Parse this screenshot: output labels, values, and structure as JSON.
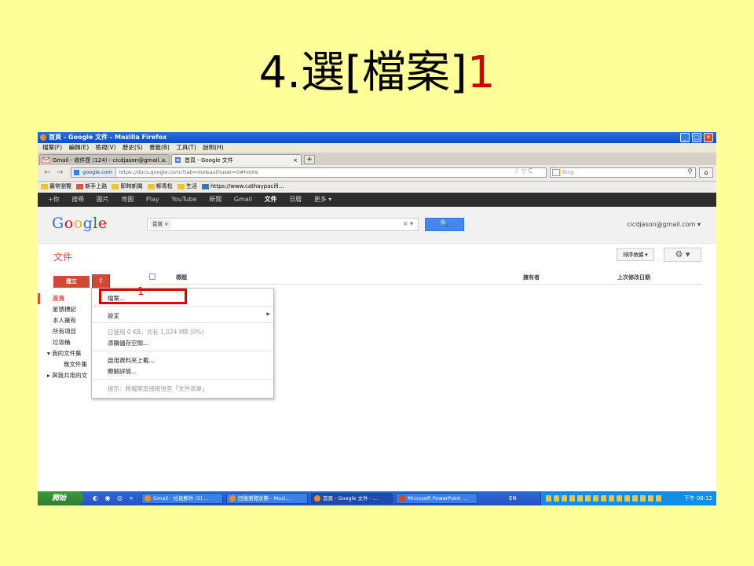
{
  "slide": {
    "title_main": "4.選[檔案]",
    "title_num": "1"
  },
  "window": {
    "title": "首頁 - Google 文件 - Mozilla Firefox",
    "buttons": [
      "_",
      "□",
      "✕"
    ]
  },
  "menubar": [
    "檔案(F)",
    "編輯(E)",
    "檢視(V)",
    "歷史(S)",
    "書籤(B)",
    "工具(T)",
    "說明(H)"
  ],
  "tabs": [
    {
      "label": "Gmail - 收件匣 (124) - cicdjason@gmail.…",
      "close": "×"
    },
    {
      "label": "首頁 - Google 文件",
      "close": "×"
    }
  ],
  "newtab": "+",
  "nav": {
    "back": "←",
    "forward": "→",
    "site": "google.com",
    "url": "https://docs.google.com/?tab=mo&authuser=0#home",
    "url_icons": "☆ ▽ C",
    "search_placeholder": "Bing",
    "search_icon": "⚲",
    "home": "⌂"
  },
  "bookmarks": [
    "最常瀏覽",
    "新手上路",
    "即時新聞",
    "柳青松",
    "生活",
    "https://www.cathaypacifi…"
  ],
  "gbar": [
    "+你",
    "搜尋",
    "圖片",
    "地圖",
    "Play",
    "YouTube",
    "新聞",
    "Gmail",
    "文件",
    "日曆",
    "更多 ▾"
  ],
  "gbar_active": 8,
  "header": {
    "logo": "Google",
    "chip": "首頁 ×",
    "clear": "× ▾",
    "search_button": "🔍",
    "account": "cicdjason@gmail.com ▾"
  },
  "docs": {
    "title": "文件",
    "sort": "排序依據 ▾",
    "gear": "⚙ ▾",
    "create": "建立",
    "upload": "⇪",
    "col_title": "標題",
    "col_owner": "擁有者",
    "col_modified": "上次修改日期"
  },
  "leftnav": [
    "首頁",
    "星號標記",
    "本人擁有",
    "所有項目",
    "垃圾桶",
    "▾ 我的文件集",
    "無文件集",
    "▸ 與我共用的文"
  ],
  "dropdown": {
    "file": "檔案...",
    "settings": "設定",
    "usage": "已使用 0 KB，共有 1,024 MB (0%)",
    "buy_storage": "添購儲存空間...",
    "enable_folder": "啟用資料夾上載...",
    "learn_more": "瞭解詳情...",
    "tip": "提示：將檔案直接拖曳至「文件清單」",
    "annotation": "1"
  },
  "taskbar": {
    "start": "開始",
    "quicklaunch": "◐ ◉ ◎ »",
    "tasks": [
      "Gmail - 垃圾郵件 (5) ...",
      "回復瀏覽狀態 - Mozi...",
      "首頁 - Google 文件 - ...",
      "Microsoft PowerPoint ..."
    ],
    "lang": "EN",
    "clock": "下午 08:12"
  }
}
